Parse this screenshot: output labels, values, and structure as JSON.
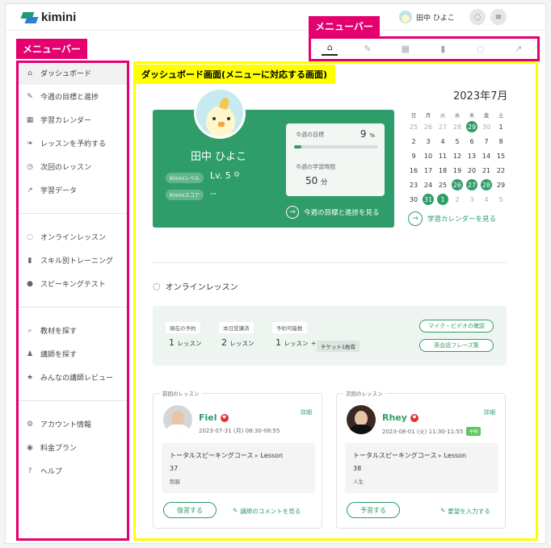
{
  "app": {
    "name": "kimini"
  },
  "user": {
    "name": "田中 ひよこ"
  },
  "annotations": {
    "left_menu_label": "メニューバー",
    "top_menu_label": "メニューバー",
    "dashboard_label": "ダッシュボード画面(メニューに対応する画面)"
  },
  "tabs": [
    {
      "icon": "home-icon",
      "glyph": "⌂",
      "active": true
    },
    {
      "icon": "pencil-icon",
      "glyph": "✎",
      "active": false
    },
    {
      "icon": "calendar-icon",
      "glyph": "▦",
      "active": false
    },
    {
      "icon": "book-icon",
      "glyph": "▮",
      "active": false
    },
    {
      "icon": "chat-icon",
      "glyph": "◌",
      "active": false
    },
    {
      "icon": "chart-icon",
      "glyph": "↗",
      "active": false
    }
  ],
  "sidebar": {
    "groups": [
      [
        {
          "label": "ダッシュボード",
          "icon": "home-icon",
          "glyph": "⌂",
          "active": true
        },
        {
          "label": "今週の目標と進捗",
          "icon": "pencil-icon",
          "glyph": "✎"
        },
        {
          "label": "学習カレンダー",
          "icon": "calendar-icon",
          "glyph": "▦"
        },
        {
          "label": "レッスンを予約する",
          "icon": "leaf-icon",
          "glyph": "❧"
        },
        {
          "label": "次回のレッスン",
          "icon": "alarm-icon",
          "glyph": "◷"
        },
        {
          "label": "学習データ",
          "icon": "chart-icon",
          "glyph": "↗"
        }
      ],
      [
        {
          "label": "オンラインレッスン",
          "icon": "chat-icon",
          "glyph": "◌"
        },
        {
          "label": "スキル別トレーニング",
          "icon": "book-icon",
          "glyph": "▮"
        },
        {
          "label": "スピーキングテスト",
          "icon": "mic-icon",
          "glyph": "●"
        }
      ],
      [
        {
          "label": "教材を探す",
          "icon": "search-icon",
          "glyph": "⌕"
        },
        {
          "label": "講師を探す",
          "icon": "teacher-icon",
          "glyph": "♟"
        },
        {
          "label": "みんなの講師レビュー",
          "icon": "star-icon",
          "glyph": "★"
        }
      ],
      [
        {
          "label": "アカウント情報",
          "icon": "gear-icon",
          "glyph": "⚙"
        },
        {
          "label": "料金プラン",
          "icon": "coin-icon",
          "glyph": "◉"
        },
        {
          "label": "ヘルプ",
          "icon": "help-icon",
          "glyph": "?"
        }
      ]
    ]
  },
  "profile": {
    "name": "田中 ひよこ",
    "level_label": "Kiminiレベル",
    "level": "Lv. 5",
    "score_label": "Kiminiスコア",
    "score": "--"
  },
  "goal": {
    "goal_label": "今週の目標",
    "goal_pct": "9",
    "goal_pct_unit": "%",
    "progress_fraction": 0.09,
    "time_label": "今週の学習時間",
    "time_value": "50",
    "time_unit": "分",
    "link": "今週の目標と進捗を見る"
  },
  "calendar": {
    "title": "2023年7月",
    "weekdays": [
      "日",
      "月",
      "火",
      "水",
      "木",
      "金",
      "土"
    ],
    "weeks": [
      [
        {
          "d": "25",
          "m": true
        },
        {
          "d": "26",
          "m": true
        },
        {
          "d": "27",
          "m": true
        },
        {
          "d": "28",
          "m": true
        },
        {
          "d": "29",
          "h": true
        },
        {
          "d": "30",
          "m": true
        },
        {
          "d": "1"
        }
      ],
      [
        {
          "d": "2"
        },
        {
          "d": "3"
        },
        {
          "d": "4"
        },
        {
          "d": "5"
        },
        {
          "d": "6"
        },
        {
          "d": "7"
        },
        {
          "d": "8"
        }
      ],
      [
        {
          "d": "9"
        },
        {
          "d": "10"
        },
        {
          "d": "11"
        },
        {
          "d": "12"
        },
        {
          "d": "13"
        },
        {
          "d": "14"
        },
        {
          "d": "15"
        }
      ],
      [
        {
          "d": "16"
        },
        {
          "d": "17"
        },
        {
          "d": "18"
        },
        {
          "d": "19"
        },
        {
          "d": "20"
        },
        {
          "d": "21"
        },
        {
          "d": "22"
        }
      ],
      [
        {
          "d": "23"
        },
        {
          "d": "24"
        },
        {
          "d": "25"
        },
        {
          "d": "26",
          "h": true
        },
        {
          "d": "27",
          "h": true
        },
        {
          "d": "28",
          "h": true
        },
        {
          "d": "29"
        }
      ],
      [
        {
          "d": "30"
        },
        {
          "d": "31",
          "h": true
        },
        {
          "d": "1",
          "h": true
        },
        {
          "d": "2",
          "m": true
        },
        {
          "d": "3",
          "m": true
        },
        {
          "d": "4",
          "m": true
        },
        {
          "d": "5",
          "m": true
        }
      ]
    ],
    "link": "学習カレンダーを見る"
  },
  "online": {
    "title": "オンラインレッスン",
    "current_label": "現在の予約",
    "current_value": "1",
    "today_label": "本日受講済",
    "today_value": "2",
    "available_label": "予約可能数",
    "available_value": "1",
    "unit": "レッスン",
    "plus": "+",
    "ticket": "チケット1枚有",
    "mic_button": "マイク・ビデオの確認",
    "phrase_button": "英会話フレーズ集"
  },
  "prev_lesson": {
    "label": "前回のレッスン",
    "detail": "詳細",
    "teacher": "Fiel",
    "date": "2023-07-31 (月) 08:30-08:55",
    "course": "トータルスピーキングコース",
    "sep": "▸",
    "lesson": "Lesson",
    "lesson_num": "37",
    "topic": "制服",
    "button": "復習する",
    "comment_link": "講師のコメントを見る"
  },
  "next_lesson": {
    "label": "次回のレッスン",
    "detail": "詳細",
    "teacher": "Rhey",
    "date": "2023-08-01 (火) 11:30-11:55",
    "badge": "予約",
    "course": "トータルスピーキングコース",
    "sep": "▸",
    "lesson": "Lesson",
    "lesson_num": "38",
    "topic": "人生",
    "button": "予習する",
    "comment_link": "要望を入力する"
  },
  "colors": {
    "accent": "#2f9d69",
    "annotation": "#e4006f",
    "highlight": "#ffff00"
  }
}
